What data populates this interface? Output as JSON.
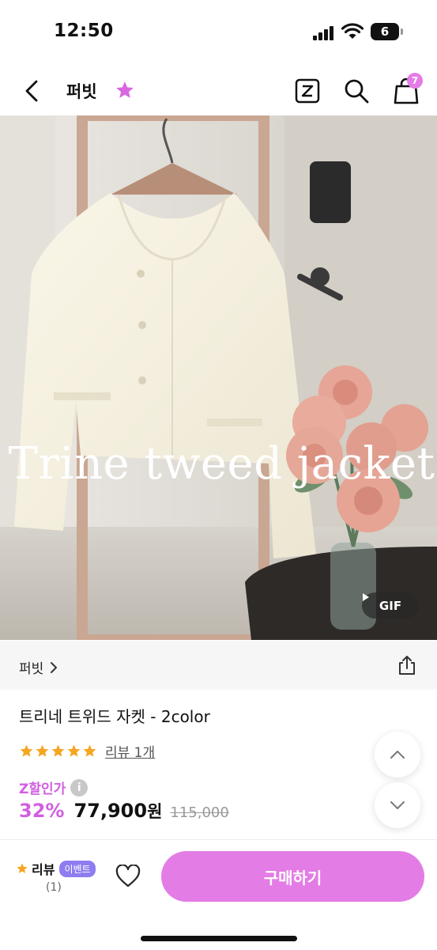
{
  "status_bar": {
    "time": "12:50",
    "battery": "6"
  },
  "nav": {
    "shop_name": "퍼빗",
    "cart_count": "7"
  },
  "hero": {
    "overlay_title": "Trine tweed jacket",
    "media_badge": "GIF"
  },
  "shop_row": {
    "shop_link": "퍼빗"
  },
  "product": {
    "title": "트리네 트위드 자켓 - 2color",
    "rating_stars": 5,
    "review_link": "리뷰 1개",
    "discount_label": "Z할인가",
    "info_icon_text": "i",
    "discount_rate": "32%",
    "price": "77,900",
    "currency": "원",
    "original_price": "115,000"
  },
  "bottom_bar": {
    "review_label": "리뷰",
    "event_badge": "이벤트",
    "review_count": "(1)",
    "buy_label": "구매하기"
  },
  "colors": {
    "accent": "#e47ce6",
    "discount": "#d15fe0",
    "star": "#f5a623",
    "event_badge": "#8d7df0"
  },
  "icons": [
    "back-arrow-icon",
    "star-icon",
    "z-logo-icon",
    "search-icon",
    "shopping-bag-icon",
    "chevron-right-icon",
    "share-icon",
    "info-icon",
    "chevron-up-icon",
    "chevron-down-icon",
    "heart-icon",
    "play-icon"
  ]
}
